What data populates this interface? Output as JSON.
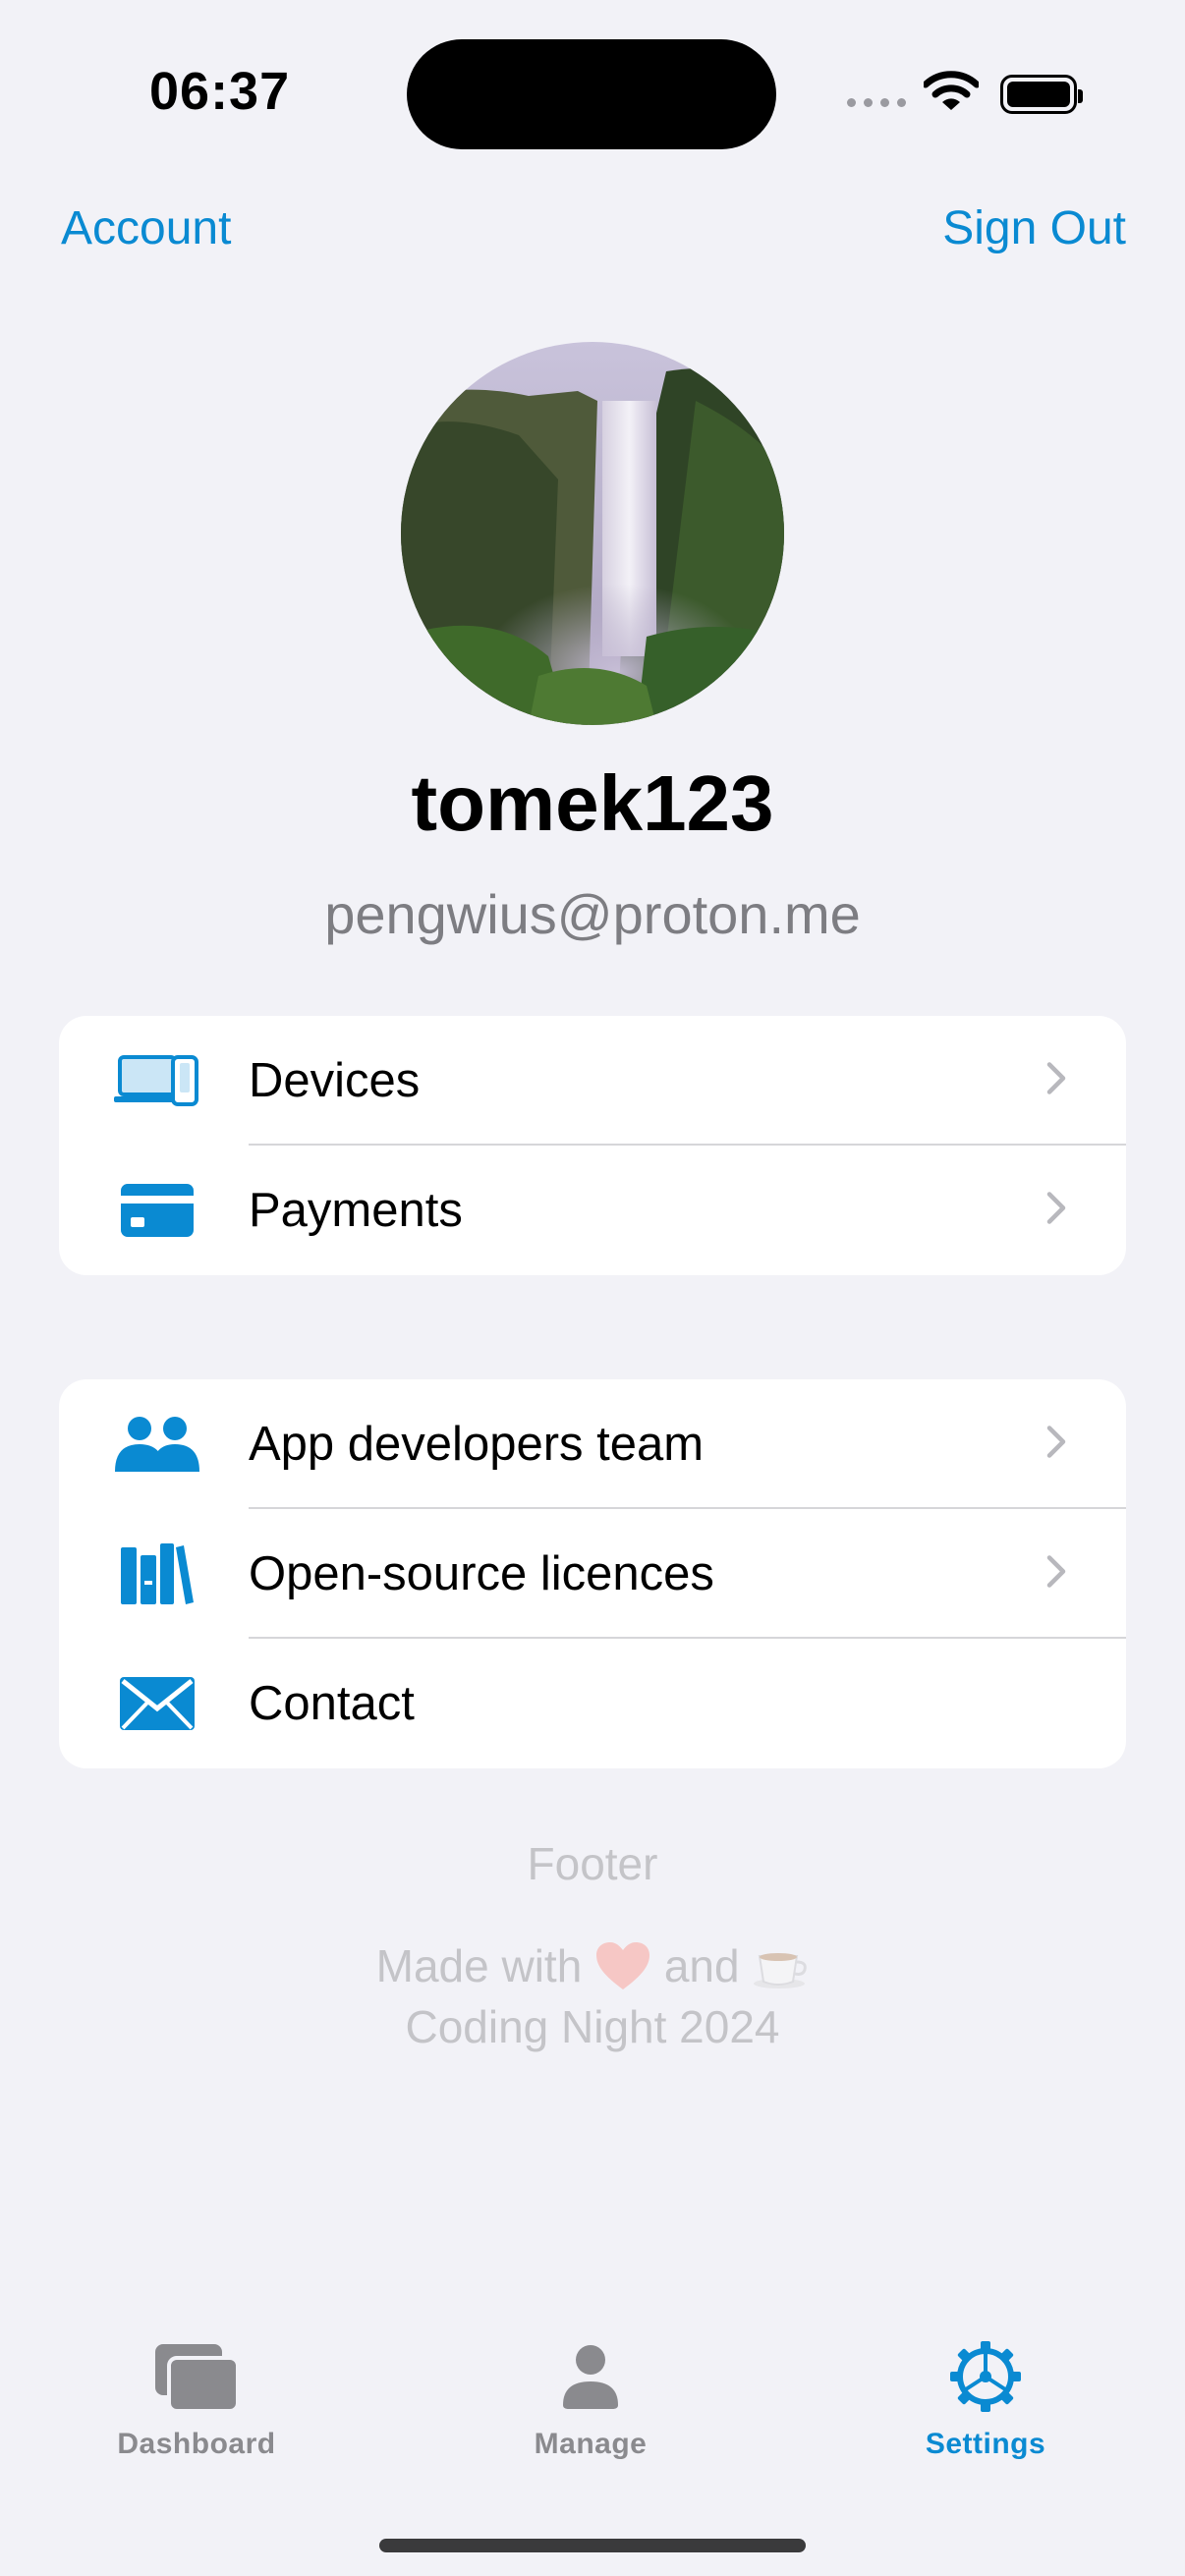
{
  "status_bar": {
    "time": "06:37"
  },
  "nav": {
    "left_label": "Account",
    "right_label": "Sign Out"
  },
  "profile": {
    "username": "tomek123",
    "email": "pengwius@proton.me"
  },
  "groups": [
    {
      "items": [
        {
          "label": "Devices",
          "icon": "devices-icon",
          "chevron": true
        },
        {
          "label": "Payments",
          "icon": "credit-card-icon",
          "chevron": true
        }
      ]
    },
    {
      "items": [
        {
          "label": "App developers team",
          "icon": "people-icon",
          "chevron": true
        },
        {
          "label": "Open-source licences",
          "icon": "books-icon",
          "chevron": true
        },
        {
          "label": "Contact",
          "icon": "envelope-icon",
          "chevron": false
        }
      ]
    }
  ],
  "footer": {
    "title": "Footer",
    "made_with_prefix": "Made with",
    "made_with_and": "and",
    "credit": "Coding Night 2024"
  },
  "tabs": [
    {
      "label": "Dashboard",
      "icon": "dashboard-icon",
      "active": false
    },
    {
      "label": "Manage",
      "icon": "person-icon",
      "active": false
    },
    {
      "label": "Settings",
      "icon": "gear-icon",
      "active": true
    }
  ],
  "colors": {
    "accent": "#0A8AD2",
    "background": "#F2F2F7",
    "secondary_text": "#7d7d82"
  }
}
